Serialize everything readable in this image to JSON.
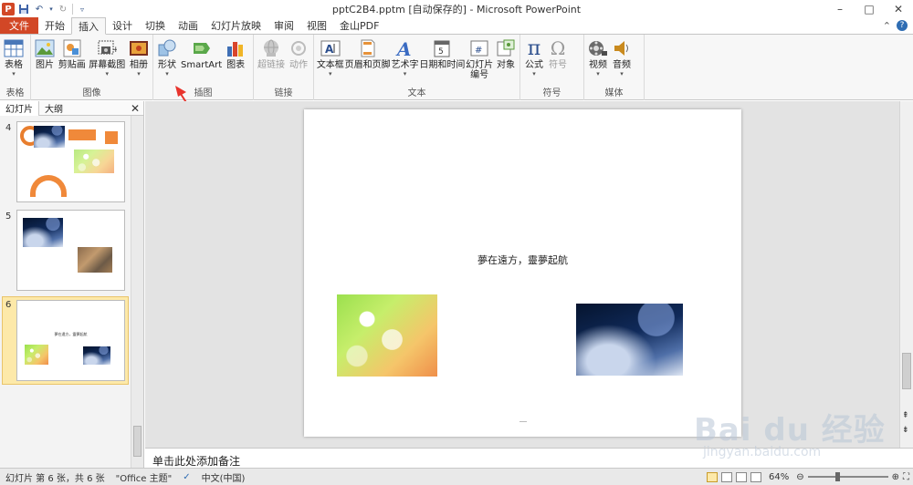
{
  "window": {
    "title": "pptC2B4.pptm [自动保存的] - Microsoft PowerPoint",
    "app_letter": "P",
    "controls": [
      "–",
      "□",
      "✕"
    ]
  },
  "tabs": {
    "file": "文件",
    "items": [
      "开始",
      "插入",
      "设计",
      "切换",
      "动画",
      "幻灯片放映",
      "审阅",
      "视图",
      "金山PDF"
    ],
    "active": "插入"
  },
  "ribbon": {
    "groups": [
      {
        "label": "表格",
        "buttons": [
          {
            "label": "表格",
            "icon": "table-icon"
          }
        ]
      },
      {
        "label": "图像",
        "buttons": [
          {
            "label": "图片",
            "icon": "picture-icon"
          },
          {
            "label": "剪贴画",
            "icon": "clipart-icon"
          },
          {
            "label": "屏幕截图",
            "icon": "screenshot-icon"
          },
          {
            "label": "相册",
            "icon": "album-icon"
          }
        ]
      },
      {
        "label": "插图",
        "buttons": [
          {
            "label": "形状",
            "icon": "shapes-icon"
          },
          {
            "label": "SmartArt",
            "icon": "smartart-icon"
          },
          {
            "label": "图表",
            "icon": "chart-icon"
          }
        ]
      },
      {
        "label": "链接",
        "buttons": [
          {
            "label": "超链接",
            "icon": "hyperlink-icon"
          },
          {
            "label": "动作",
            "icon": "action-icon"
          }
        ]
      },
      {
        "label": "文本",
        "buttons": [
          {
            "label": "文本框",
            "icon": "textbox-icon"
          },
          {
            "label": "页眉和页脚",
            "icon": "header-footer-icon"
          },
          {
            "label": "艺术字",
            "icon": "wordart-icon"
          },
          {
            "label": "日期和时间",
            "icon": "datetime-icon"
          },
          {
            "label": "幻灯片\n编号",
            "icon": "slide-number-icon"
          },
          {
            "label": "对象",
            "icon": "object-icon"
          }
        ]
      },
      {
        "label": "符号",
        "buttons": [
          {
            "label": "公式",
            "icon": "equation-icon"
          },
          {
            "label": "符号",
            "icon": "symbol-icon"
          }
        ]
      },
      {
        "label": "媒体",
        "buttons": [
          {
            "label": "视频",
            "icon": "video-icon"
          },
          {
            "label": "音频",
            "icon": "audio-icon"
          }
        ]
      }
    ]
  },
  "left_panel": {
    "tabs": [
      "幻灯片",
      "大纲"
    ],
    "slides": [
      {
        "number": "4"
      },
      {
        "number": "5"
      },
      {
        "number": "6",
        "text": "夢在遠方，靈夢起航"
      }
    ]
  },
  "slide": {
    "title_text": "夢在遠方，靈夢起航"
  },
  "notes": {
    "placeholder": "单击此处添加备注"
  },
  "statusbar": {
    "slide_info": "幻灯片 第 6 张，共 6 张",
    "theme": "\"Office 主题\"",
    "language": "中文(中国)",
    "zoom": "64%"
  },
  "watermark": {
    "brand": "Bai du 经验",
    "url": "jingyan.baidu.com"
  }
}
